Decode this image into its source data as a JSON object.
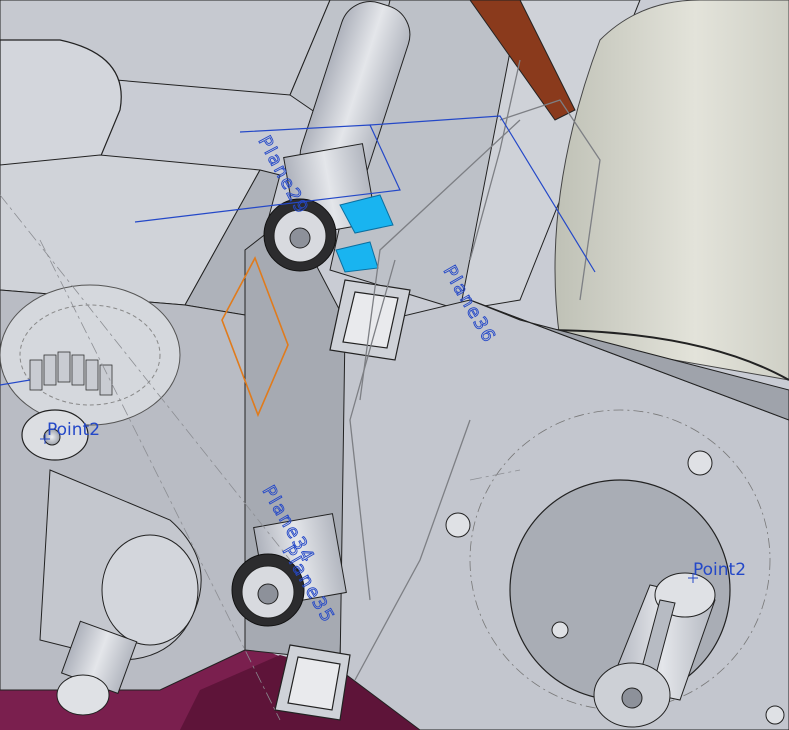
{
  "viewport": {
    "planes": [
      {
        "id": "plane-29",
        "label": "Plane29"
      },
      {
        "id": "plane-34",
        "label": "Plane34"
      },
      {
        "id": "plane-35",
        "label": "Plane35"
      },
      {
        "id": "plane-36",
        "label": "Plane36"
      }
    ],
    "points": [
      {
        "id": "point-left",
        "label": "Point2"
      },
      {
        "id": "point-right",
        "label": "Point2"
      }
    ]
  },
  "colors": {
    "body": "#c9ccd4",
    "plane_line": "#2448c8",
    "selected_face": "#19b4f0",
    "sketch_line": "#e07b1c",
    "base_plate": "#7a1f4e"
  }
}
